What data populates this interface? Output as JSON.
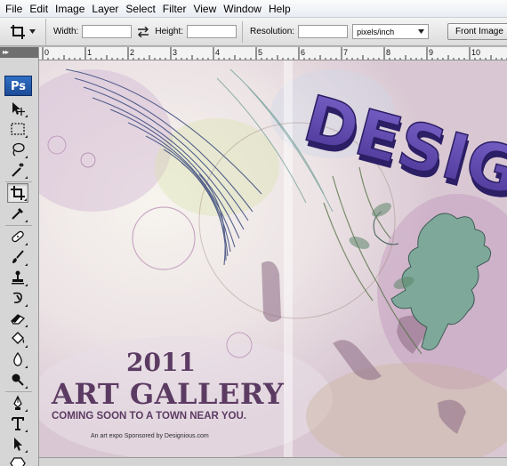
{
  "menu": [
    "File",
    "Edit",
    "Image",
    "Layer",
    "Select",
    "Filter",
    "View",
    "Window",
    "Help"
  ],
  "options": {
    "width_label": "Width:",
    "width_value": "",
    "height_label": "Height:",
    "height_value": "",
    "resolution_label": "Resolution:",
    "resolution_value": "",
    "units": "pixels/inch",
    "front_image_label": "Front Image"
  },
  "toolbox": {
    "header": "▸▸",
    "logo": "Ps",
    "active_tool": "crop"
  },
  "ruler": {
    "ticks": [
      "0",
      "1",
      "2",
      "3",
      "4",
      "5",
      "6",
      "7",
      "8",
      "9",
      "10"
    ]
  },
  "artwork": {
    "year": "2011",
    "title": "ART GALLERY",
    "subtitle": "COMING SOON TO A TOWN NEAR YOU.",
    "credit": "An art expo Sponsored by Designious.com",
    "banner": "DESIGN"
  },
  "colors": {
    "title_color": "#5c3b63",
    "banner_color": "#5b43a8",
    "lion_color": "#7ea89a",
    "ps_blue": "#2b66b8"
  }
}
